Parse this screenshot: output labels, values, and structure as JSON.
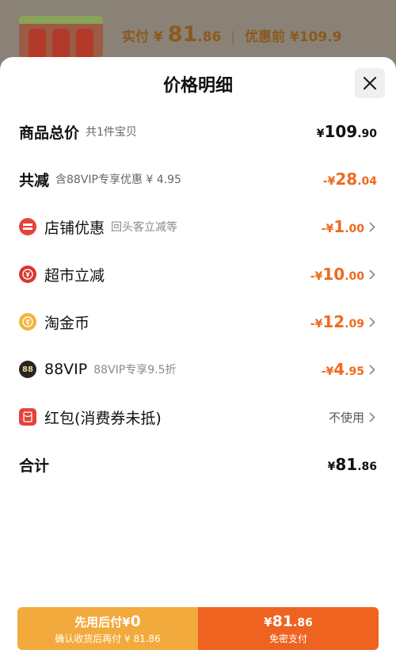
{
  "header": {
    "paid_label": "实付",
    "paid_currency": "¥",
    "paid_int": "81",
    "paid_dec": ".86",
    "before_label": "优惠前",
    "before_amount": "¥109.9"
  },
  "sheet": {
    "title": "价格明细"
  },
  "rows": {
    "total": {
      "label": "商品总价",
      "sub": "共1件宝贝",
      "cur": "¥",
      "int": "109",
      "dec": ".90"
    },
    "reduce": {
      "label": "共减",
      "sub": "含88VIP专享优惠 ¥ 4.95",
      "cur": "-¥",
      "int": "28",
      "dec": ".04"
    },
    "shop": {
      "label": "店铺优惠",
      "sub": "回头客立减等",
      "cur": "-¥",
      "int": "1",
      "dec": ".00",
      "icon": "shop-discount-icon",
      "color": "#e8413b"
    },
    "market": {
      "label": "超市立减",
      "cur": "-¥",
      "int": "10",
      "dec": ".00",
      "icon": "supermarket-discount-icon",
      "color": "#d8382e"
    },
    "coin": {
      "label": "淘金币",
      "cur": "-¥",
      "int": "12",
      "dec": ".09",
      "icon": "gold-coin-icon",
      "color": "#f3b33a"
    },
    "vip": {
      "label": "88VIP",
      "sub": "88VIP专享9.5折",
      "cur": "-¥",
      "int": "4",
      "dec": ".95",
      "icon": "vip-badge-icon",
      "icon_text": "88",
      "color": "#2a2320"
    },
    "redpacket": {
      "label": "红包(消费券未抵)",
      "value": "不使用",
      "icon": "red-packet-icon",
      "color": "#e4443c"
    },
    "sum": {
      "label": "合计",
      "cur": "¥",
      "int": "81",
      "dec": ".86"
    }
  },
  "actions": {
    "left_main_text": "先用后付",
    "left_main_cur": "¥",
    "left_main_amount": "0",
    "left_sub": "确认收货后再付 ¥ 81.86",
    "right_cur": "¥",
    "right_int": "81",
    "right_dec": ".86",
    "right_sub": "免密支付"
  },
  "colors": {
    "accent_orange": "#ef6a1e",
    "left_button": "#f2aa3c",
    "right_button": "#ef6320"
  }
}
